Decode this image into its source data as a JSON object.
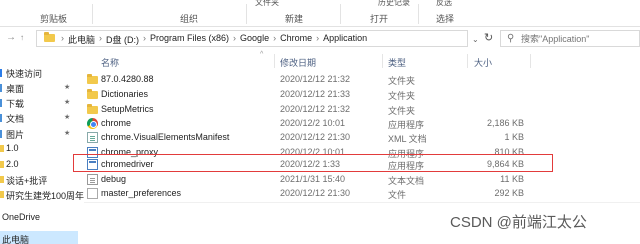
{
  "ribbon": {
    "top_labels": [
      "文件夹",
      "历史记录",
      "反选"
    ],
    "groups": [
      "剪贴板",
      "组织",
      "新建",
      "打开",
      "选择"
    ]
  },
  "address": {
    "crumbs": [
      "此电脑",
      "D盘 (D:)",
      "Program Files (x86)",
      "Google",
      "Chrome",
      "Application"
    ],
    "search_placeholder": "搜索\"Application\""
  },
  "nav": {
    "items": [
      {
        "label": "快速访问",
        "pinned": false
      },
      {
        "label": "桌面",
        "pinned": true
      },
      {
        "label": "下载",
        "pinned": true
      },
      {
        "label": "文档",
        "pinned": true
      },
      {
        "label": "图片",
        "pinned": true
      },
      {
        "label": "1.0",
        "pinned": false
      },
      {
        "label": "2.0",
        "pinned": false
      },
      {
        "label": "谈话+批评",
        "pinned": false
      },
      {
        "label": "研究生建党100周年",
        "pinned": false
      },
      {
        "label": "OneDrive",
        "pinned": false
      },
      {
        "label": "此电脑",
        "pinned": false
      }
    ]
  },
  "columns": {
    "name": "名称",
    "date": "修改日期",
    "type": "类型",
    "size": "大小"
  },
  "files": [
    {
      "name": "87.0.4280.88",
      "date": "2020/12/12 21:32",
      "type": "文件夹",
      "size": "",
      "icon": "folder-icon"
    },
    {
      "name": "Dictionaries",
      "date": "2020/12/12 21:33",
      "type": "文件夹",
      "size": "",
      "icon": "folder-icon"
    },
    {
      "name": "SetupMetrics",
      "date": "2020/12/12 21:32",
      "type": "文件夹",
      "size": "",
      "icon": "folder-icon"
    },
    {
      "name": "chrome",
      "date": "2020/12/2 10:01",
      "type": "应用程序",
      "size": "2,186 KB",
      "icon": "chrome-icon"
    },
    {
      "name": "chrome.VisualElementsManifest",
      "date": "2020/12/12 21:30",
      "type": "XML 文档",
      "size": "1 KB",
      "icon": "xml-file-icon"
    },
    {
      "name": "chrome_proxy",
      "date": "2020/12/2 10:01",
      "type": "应用程序",
      "size": "810 KB",
      "icon": "app-icon"
    },
    {
      "name": "chromedriver",
      "date": "2020/12/2 1:33",
      "type": "应用程序",
      "size": "9,864 KB",
      "icon": "app-icon"
    },
    {
      "name": "debug",
      "date": "2021/1/31 15:40",
      "type": "文本文档",
      "size": "11 KB",
      "icon": "text-file-icon"
    },
    {
      "name": "master_preferences",
      "date": "2020/12/12 21:30",
      "type": "文件",
      "size": "292 KB",
      "icon": "file-icon"
    }
  ],
  "highlight_color": "#e23b3b",
  "watermark": "CSDN @前端江太公"
}
